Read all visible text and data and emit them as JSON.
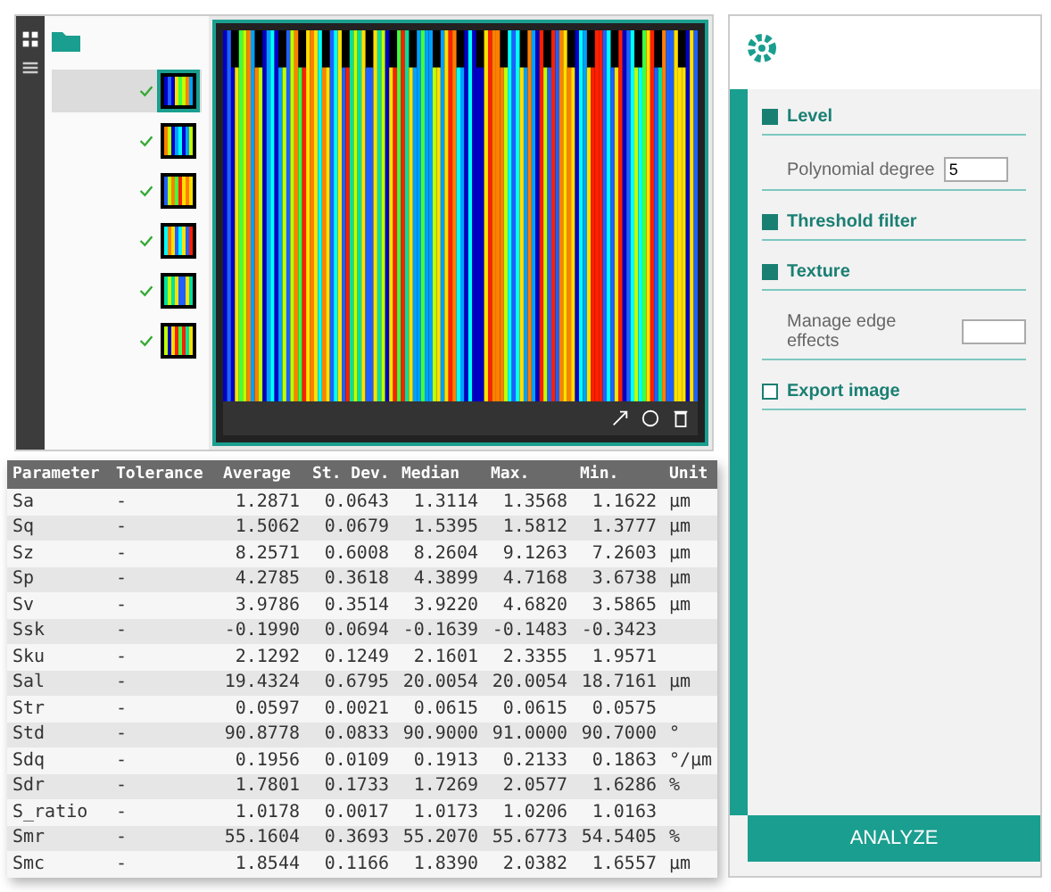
{
  "sidebar": {
    "files": [
      {
        "selected": true
      },
      {
        "selected": false
      },
      {
        "selected": false
      },
      {
        "selected": false
      },
      {
        "selected": false
      },
      {
        "selected": false
      }
    ]
  },
  "settings": {
    "options": [
      {
        "kind": "checkbox",
        "label": "Level",
        "checked": true
      },
      {
        "kind": "field",
        "label": "Polynomial degree",
        "value": "5"
      },
      {
        "kind": "checkbox",
        "label": "Threshold filter",
        "checked": true
      },
      {
        "kind": "checkbox",
        "label": "Texture",
        "checked": true
      },
      {
        "kind": "field",
        "label": "Manage edge effects"
      },
      {
        "kind": "checkbox",
        "label": "Export image",
        "checked": false
      }
    ],
    "action": "ANALYZE"
  },
  "table": {
    "columns": [
      "Parameter",
      "Tolerance",
      "Average",
      "St. Dev.",
      "Median",
      "Max.",
      "Min.",
      "Unit"
    ],
    "rows": [
      [
        "Sa",
        "-",
        "1.2871",
        "0.0643",
        "1.3114",
        "1.3568",
        "1.1622",
        "µm"
      ],
      [
        "Sq",
        "-",
        "1.5062",
        "0.0679",
        "1.5395",
        "1.5812",
        "1.3777",
        "µm"
      ],
      [
        "Sz",
        "-",
        "8.2571",
        "0.6008",
        "8.2604",
        "9.1263",
        "7.2603",
        "µm"
      ],
      [
        "Sp",
        "-",
        "4.2785",
        "0.3618",
        "4.3899",
        "4.7168",
        "3.6738",
        "µm"
      ],
      [
        "Sv",
        "-",
        "3.9786",
        "0.3514",
        "3.9220",
        "4.6820",
        "3.5865",
        "µm"
      ],
      [
        "Ssk",
        "-",
        "-0.1990",
        "0.0694",
        "-0.1639",
        "-0.1483",
        "-0.3423",
        ""
      ],
      [
        "Sku",
        "-",
        "2.1292",
        "0.1249",
        "2.1601",
        "2.3355",
        "1.9571",
        ""
      ],
      [
        "Sal",
        "-",
        "19.4324",
        "0.6795",
        "20.0054",
        "20.0054",
        "18.7161",
        "µm"
      ],
      [
        "Str",
        "-",
        "0.0597",
        "0.0021",
        "0.0615",
        "0.0615",
        "0.0575",
        ""
      ],
      [
        "Std",
        "-",
        "90.8778",
        "0.0833",
        "90.9000",
        "91.0000",
        "90.7000",
        "°"
      ],
      [
        "Sdq",
        "-",
        "0.1956",
        "0.0109",
        "0.1913",
        "0.2133",
        "0.1863",
        "°/µm"
      ],
      [
        "Sdr",
        "-",
        "1.7801",
        "0.1733",
        "1.7269",
        "2.0577",
        "1.6286",
        "%"
      ],
      [
        "S_ratio",
        "-",
        "1.0178",
        "0.0017",
        "1.0173",
        "1.0206",
        "1.0163",
        ""
      ],
      [
        "Smr",
        "-",
        "55.1604",
        "0.3693",
        "55.2070",
        "55.6773",
        "54.5405",
        "%"
      ],
      [
        "Smc",
        "-",
        "1.8544",
        "0.1166",
        "1.8390",
        "2.0382",
        "1.6557",
        "µm"
      ]
    ]
  }
}
